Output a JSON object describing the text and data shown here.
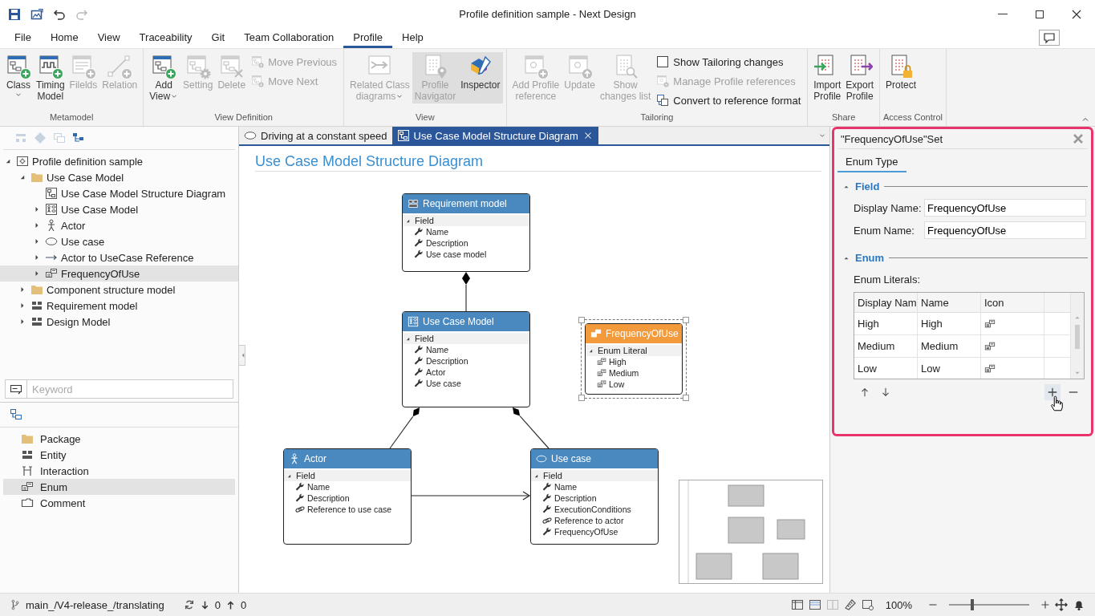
{
  "window": {
    "title": "Profile definition sample - Next Design"
  },
  "menu": [
    {
      "label": "File",
      "selected": false
    },
    {
      "label": "Home",
      "selected": false
    },
    {
      "label": "View",
      "selected": false
    },
    {
      "label": "Traceability",
      "selected": false
    },
    {
      "label": "Git",
      "selected": false
    },
    {
      "label": "Team Collaboration",
      "selected": false
    },
    {
      "label": "Profile",
      "selected": true
    },
    {
      "label": "Help",
      "selected": false
    }
  ],
  "ribbon": [
    {
      "label": "Metamodel",
      "buttons": [
        {
          "kind": "large",
          "lines": [
            "Class"
          ],
          "dropdown": true,
          "disabled": false,
          "selected": false
        },
        {
          "kind": "large",
          "lines": [
            "Timing",
            "Model"
          ],
          "dropdown": false,
          "disabled": false,
          "selected": false
        },
        {
          "kind": "large",
          "lines": [
            "Filelds"
          ],
          "dropdown": false,
          "disabled": true,
          "selected": false
        },
        {
          "kind": "large",
          "lines": [
            "Relation"
          ],
          "dropdown": false,
          "disabled": true,
          "selected": false
        }
      ]
    },
    {
      "label": "View Definition",
      "buttons": [
        {
          "kind": "large",
          "lines": [
            "Add",
            "View"
          ],
          "dropdown": true,
          "disabled": false,
          "selected": false
        },
        {
          "kind": "large",
          "lines": [
            "Setting"
          ],
          "dropdown": false,
          "disabled": true,
          "selected": false
        },
        {
          "kind": "large",
          "lines": [
            "Delete"
          ],
          "dropdown": false,
          "disabled": true,
          "selected": false
        },
        {
          "kind": "small",
          "lines": [
            "Move Previous"
          ],
          "disabled": true
        },
        {
          "kind": "small",
          "lines": [
            "Move Next"
          ],
          "disabled": true
        }
      ]
    },
    {
      "label": "View",
      "buttons": [
        {
          "kind": "large",
          "lines": [
            "Related Class",
            "diagrams"
          ],
          "dropdown": true,
          "disabled": true,
          "selected": false
        },
        {
          "kind": "large",
          "lines": [
            "Profile",
            "Navigator"
          ],
          "dropdown": false,
          "disabled": true,
          "selected": true
        },
        {
          "kind": "large",
          "lines": [
            "Inspector"
          ],
          "dropdown": false,
          "disabled": false,
          "selected": true
        }
      ]
    },
    {
      "label": "Tailoring",
      "buttons": [
        {
          "kind": "large",
          "lines": [
            "Add Profile",
            "reference"
          ],
          "dropdown": false,
          "disabled": true,
          "selected": false
        },
        {
          "kind": "large",
          "lines": [
            "Update"
          ],
          "dropdown": false,
          "disabled": true,
          "selected": false
        },
        {
          "kind": "large",
          "lines": [
            "Show",
            "changes list"
          ],
          "dropdown": false,
          "disabled": true,
          "selected": false
        },
        {
          "kind": "checkbox",
          "lines": [
            "Show Tailoring changes"
          ],
          "checked": false,
          "disabled": false
        },
        {
          "kind": "small",
          "lines": [
            "Manage Profile references"
          ],
          "disabled": true
        },
        {
          "kind": "small",
          "lines": [
            "Convert to reference format"
          ],
          "disabled": false
        }
      ]
    },
    {
      "label": "Share",
      "buttons": [
        {
          "kind": "large",
          "lines": [
            "Import",
            "Profile"
          ],
          "dropdown": false,
          "disabled": false,
          "selected": false
        },
        {
          "kind": "large",
          "lines": [
            "Export",
            "Profile"
          ],
          "dropdown": false,
          "disabled": false,
          "selected": false
        }
      ]
    },
    {
      "label": "Access Control",
      "buttons": [
        {
          "kind": "large",
          "lines": [
            "Protect"
          ],
          "dropdown": false,
          "disabled": false,
          "selected": false
        }
      ]
    }
  ],
  "tree": [
    {
      "label": "Profile definition sample",
      "kind": "profile",
      "expandable": true,
      "expanded": true,
      "selected": false,
      "children": [
        {
          "label": "Use Case Model",
          "kind": "folder",
          "expandable": true,
          "expanded": true,
          "selected": false,
          "children": [
            {
              "label": "Use Case Model Structure Diagram",
              "kind": "diagram",
              "expandable": false,
              "selected": false
            },
            {
              "label": "Use Case Model",
              "kind": "usecase-model",
              "expandable": true,
              "expanded": false,
              "selected": false
            },
            {
              "label": "Actor",
              "kind": "actor",
              "expandable": true,
              "expanded": false,
              "selected": false
            },
            {
              "label": "Use case",
              "kind": "usecase",
              "expandable": true,
              "expanded": false,
              "selected": false
            },
            {
              "label": "Actor to UseCase Reference",
              "kind": "reference",
              "expandable": true,
              "expanded": false,
              "selected": false
            },
            {
              "label": "FrequencyOfUse",
              "kind": "enum",
              "expandable": true,
              "expanded": false,
              "selected": true
            }
          ]
        },
        {
          "label": "Component structure model",
          "kind": "folder",
          "expandable": true,
          "expanded": false,
          "selected": false
        },
        {
          "label": "Requirement model",
          "kind": "entity",
          "expandable": true,
          "expanded": false,
          "selected": false
        },
        {
          "label": "Design Model",
          "kind": "entity",
          "expandable": true,
          "expanded": false,
          "selected": false
        }
      ]
    }
  ],
  "search": {
    "placeholder": "Keyword"
  },
  "palette": [
    {
      "label": "Package",
      "kind": "folder",
      "selected": false
    },
    {
      "label": "Entity",
      "kind": "entity",
      "selected": false
    },
    {
      "label": "Interaction",
      "kind": "interaction",
      "selected": false
    },
    {
      "label": "Enum",
      "kind": "enum",
      "selected": true
    },
    {
      "label": "Comment",
      "kind": "comment",
      "selected": false
    }
  ],
  "editor_tabs": [
    {
      "label": "Driving at a constant speed",
      "kind": "usecase",
      "selected": false,
      "closable": false
    },
    {
      "label": "Use Case Model Structure Diagram",
      "kind": "diagram",
      "selected": true,
      "closable": true
    }
  ],
  "diagram": {
    "title": "Use Case Model Structure Diagram",
    "nodes": [
      {
        "title": "Requirement model",
        "kind": "entity",
        "selected": false,
        "section": {
          "label": "Field",
          "expanded": true
        },
        "items": [
          {
            "label": "Name",
            "kind": "field"
          },
          {
            "label": "Description",
            "kind": "field"
          },
          {
            "label": "Use case model",
            "kind": "field"
          }
        ]
      },
      {
        "title": "Use Case Model",
        "kind": "usecase-model",
        "selected": false,
        "section": {
          "label": "Field",
          "expanded": true
        },
        "items": [
          {
            "label": "Name",
            "kind": "field"
          },
          {
            "label": "Description",
            "kind": "field"
          },
          {
            "label": "Actor",
            "kind": "field"
          },
          {
            "label": "Use case",
            "kind": "field"
          }
        ]
      },
      {
        "title": "FrequencyOfUse",
        "kind": "enum",
        "selected": true,
        "section": {
          "label": "Enum Literal",
          "expanded": true
        },
        "items": [
          {
            "label": "High",
            "kind": "literal"
          },
          {
            "label": "Medium",
            "kind": "literal"
          },
          {
            "label": "Low",
            "kind": "literal"
          }
        ]
      },
      {
        "title": "Actor",
        "kind": "actor",
        "selected": false,
        "section": {
          "label": "Field",
          "expanded": true
        },
        "items": [
          {
            "label": "Name",
            "kind": "field"
          },
          {
            "label": "Description",
            "kind": "field"
          },
          {
            "label": "Reference to use case",
            "kind": "reference"
          }
        ]
      },
      {
        "title": "Use case",
        "kind": "usecase",
        "selected": false,
        "section": {
          "label": "Field",
          "expanded": true
        },
        "items": [
          {
            "label": "Name",
            "kind": "field"
          },
          {
            "label": "Description",
            "kind": "field"
          },
          {
            "label": "ExecutionConditions",
            "kind": "field"
          },
          {
            "label": "Reference to actor",
            "kind": "reference"
          },
          {
            "label": "FrequencyOfUse",
            "kind": "field"
          }
        ]
      }
    ]
  },
  "inspector": {
    "title": "\"FrequencyOfUse\"Set",
    "tabs": [
      {
        "label": "Enum Type",
        "selected": true
      }
    ],
    "field_section": {
      "title": "Field",
      "expanded": true,
      "fields": [
        {
          "label": "Display Name:",
          "value": "FrequencyOfUse"
        },
        {
          "label": "Enum Name:",
          "value": "FrequencyOfUse"
        }
      ]
    },
    "enum_section": {
      "title": "Enum",
      "expanded": true,
      "literals_label": "Enum Literals:",
      "columns": [
        "Display Nam",
        "Name",
        "Icon"
      ],
      "rows": [
        {
          "display_name": "High",
          "name": "High"
        },
        {
          "display_name": "Medium",
          "name": "Medium"
        },
        {
          "display_name": "Low",
          "name": "Low"
        }
      ]
    }
  },
  "status_bar": {
    "branch": "main_/V4-release_/translating",
    "incoming": "0",
    "outgoing": "0",
    "zoom": "100%",
    "zoom_slider": {
      "level": 0.28
    }
  }
}
